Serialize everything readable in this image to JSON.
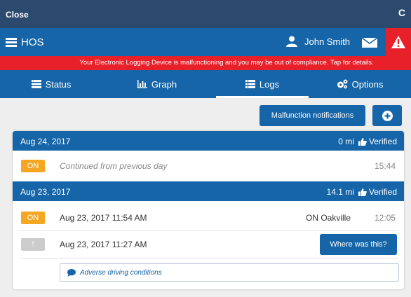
{
  "topbar": {
    "close_label": "Close",
    "refresh_glyph": "C"
  },
  "header": {
    "menu_title": "HOS",
    "user_name": "John Smith",
    "icons": [
      "hamburger-icon",
      "user-icon",
      "mail-icon",
      "warning-icon"
    ]
  },
  "banner": {
    "text": "Your Electronic Logging Device is malfunctioning and you may be out of compliance. Tap for details."
  },
  "tabs": [
    {
      "label": "Status",
      "icon": "status-icon",
      "active": false
    },
    {
      "label": "Graph",
      "icon": "graph-icon",
      "active": false
    },
    {
      "label": "Logs",
      "icon": "list-icon",
      "active": true
    },
    {
      "label": "Options",
      "icon": "gears-icon",
      "active": false
    }
  ],
  "toolbar": {
    "malfunction_label": "Malfunction notifications",
    "add_icon": "plus-circle-icon"
  },
  "days": [
    {
      "date": "Aug 24, 2017",
      "distance": "0 mi",
      "status": "Verified",
      "rows": [
        {
          "badge": "ON",
          "text": "Continued from previous day",
          "time": "15:44"
        }
      ]
    },
    {
      "date": "Aug 23, 2017",
      "distance": "14.1 mi",
      "status": "Verified",
      "rows": [
        {
          "badge": "ON",
          "text": "Aug 23, 2017 11:54 AM",
          "location": "ON Oakville",
          "time": "12:05"
        },
        {
          "badge": "!",
          "text": "Aug 23, 2017 11:27 AM",
          "action_label": "Where was this?"
        }
      ],
      "note": "Adverse driving conditions"
    }
  ],
  "colors": {
    "primary": "#1565a8",
    "topbar": "#2c4a6e",
    "alert": "#e8202a",
    "on_badge": "#f5a623",
    "unknown_badge": "#cccccc"
  }
}
